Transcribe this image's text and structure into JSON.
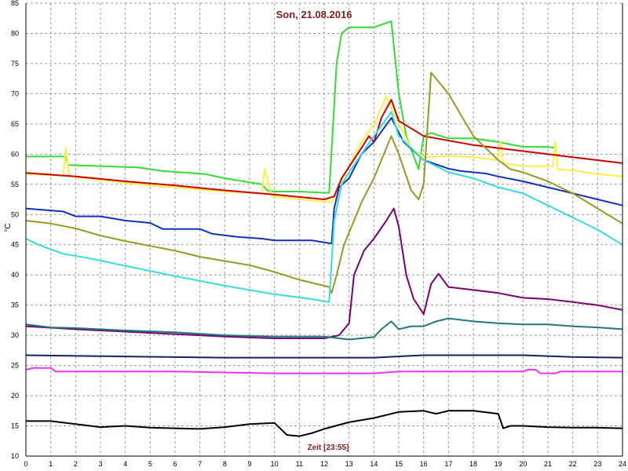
{
  "chart_data": {
    "type": "line",
    "title": "Son, 21.08.2016",
    "xlabel": "Zeit [23:55]",
    "ylabel": "°C",
    "xlim": [
      0,
      24
    ],
    "ylim": [
      10,
      85
    ],
    "x_ticks": [
      0,
      1,
      2,
      3,
      4,
      5,
      6,
      7,
      8,
      9,
      10,
      11,
      12,
      13,
      14,
      15,
      16,
      17,
      18,
      19,
      20,
      21,
      22,
      23,
      24
    ],
    "y_ticks": [
      10,
      15,
      20,
      25,
      30,
      35,
      40,
      45,
      50,
      55,
      60,
      65,
      70,
      75,
      80,
      85
    ],
    "grid": true,
    "series": [
      {
        "color": "#33dd33",
        "points": [
          [
            0,
            59.6
          ],
          [
            1.6,
            59.6
          ],
          [
            1.7,
            58.2
          ],
          [
            4.5,
            57.8
          ],
          [
            5.5,
            57.2
          ],
          [
            7.2,
            56.7
          ],
          [
            8,
            56
          ],
          [
            9.5,
            55
          ],
          [
            9.7,
            54
          ],
          [
            10,
            53.8
          ],
          [
            11,
            53.8
          ],
          [
            12,
            53.6
          ],
          [
            12.2,
            53.6
          ],
          [
            12.5,
            75
          ],
          [
            12.7,
            80
          ],
          [
            13,
            81
          ],
          [
            14,
            81
          ],
          [
            14.7,
            82
          ],
          [
            15,
            70
          ],
          [
            15.3,
            63
          ],
          [
            15.8,
            57.5
          ],
          [
            16,
            63
          ],
          [
            16.3,
            63.5
          ],
          [
            17,
            62.6
          ],
          [
            18,
            62.6
          ],
          [
            19,
            62
          ],
          [
            20,
            61.2
          ],
          [
            21,
            61.2
          ],
          [
            21.3,
            61
          ]
        ]
      },
      {
        "color": "#ffee44",
        "points": [
          [
            0,
            56.7
          ],
          [
            1.5,
            56.4
          ],
          [
            1.6,
            61
          ],
          [
            1.75,
            56.3
          ],
          [
            5,
            54.8
          ],
          [
            8,
            53.8
          ],
          [
            9.5,
            53.5
          ],
          [
            9.6,
            57.6
          ],
          [
            9.9,
            53
          ],
          [
            12.3,
            52
          ],
          [
            12.5,
            54
          ],
          [
            13.5,
            62
          ],
          [
            14,
            65
          ],
          [
            14.5,
            69.5
          ],
          [
            15,
            65
          ],
          [
            15.5,
            61
          ],
          [
            16,
            59.5
          ],
          [
            17,
            59.7
          ],
          [
            18,
            59.5
          ],
          [
            19,
            59
          ],
          [
            19.1,
            62.2
          ],
          [
            19.2,
            58.5
          ],
          [
            20,
            58
          ],
          [
            21.2,
            58
          ],
          [
            21.3,
            62
          ],
          [
            21.4,
            57.5
          ],
          [
            22,
            57.3
          ],
          [
            23,
            56.7
          ],
          [
            24,
            56.3
          ]
        ]
      },
      {
        "color": "#cc0000",
        "points": [
          [
            0,
            56.9
          ],
          [
            2,
            56.3
          ],
          [
            4,
            55.5
          ],
          [
            6,
            54.8
          ],
          [
            8,
            54
          ],
          [
            10,
            53.3
          ],
          [
            12,
            52.5
          ],
          [
            12.4,
            53
          ],
          [
            12.7,
            56
          ],
          [
            13.5,
            61
          ],
          [
            13.8,
            63
          ],
          [
            14,
            62
          ],
          [
            14.3,
            66
          ],
          [
            14.7,
            69
          ],
          [
            15,
            65.5
          ],
          [
            16,
            63
          ],
          [
            18,
            61.5
          ],
          [
            20,
            60.5
          ],
          [
            22,
            59.5
          ],
          [
            24,
            58.5
          ]
        ]
      },
      {
        "color": "#1133bb",
        "points": [
          [
            0,
            51
          ],
          [
            1.5,
            50.5
          ],
          [
            2,
            49.7
          ],
          [
            3,
            49.7
          ],
          [
            4,
            49
          ],
          [
            5,
            48.6
          ],
          [
            5.5,
            47.6
          ],
          [
            7,
            47.6
          ],
          [
            7.5,
            46.8
          ],
          [
            8.5,
            46.3
          ],
          [
            9.5,
            46
          ],
          [
            10,
            45.7
          ],
          [
            11.5,
            45.7
          ],
          [
            12.3,
            45.2
          ],
          [
            12.4,
            51
          ],
          [
            12.6,
            54.5
          ],
          [
            13,
            56
          ],
          [
            13.5,
            60
          ],
          [
            14,
            62
          ],
          [
            14.7,
            66
          ],
          [
            15.2,
            62
          ],
          [
            16,
            59
          ],
          [
            17,
            57.6
          ],
          [
            17.5,
            57.2
          ],
          [
            18.5,
            56.8
          ],
          [
            19,
            56.3
          ],
          [
            20,
            55.5
          ],
          [
            21,
            54.5
          ],
          [
            22,
            53.5
          ],
          [
            23,
            52.5
          ],
          [
            24,
            51.5
          ]
        ]
      },
      {
        "color": "#999922",
        "points": [
          [
            0,
            49
          ],
          [
            1,
            48.5
          ],
          [
            2,
            47.7
          ],
          [
            3,
            46.5
          ],
          [
            4,
            45.6
          ],
          [
            5,
            44.8
          ],
          [
            6,
            44
          ],
          [
            7,
            43
          ],
          [
            8,
            42.3
          ],
          [
            9,
            41.6
          ],
          [
            10,
            40.5
          ],
          [
            11,
            39.2
          ],
          [
            12,
            38.2
          ],
          [
            12.2,
            38
          ],
          [
            12.3,
            37
          ],
          [
            12.5,
            40
          ],
          [
            12.8,
            45
          ],
          [
            13.5,
            52
          ],
          [
            14,
            56
          ],
          [
            14.7,
            63
          ],
          [
            15,
            60
          ],
          [
            15.5,
            54
          ],
          [
            15.8,
            52.5
          ],
          [
            16,
            55
          ],
          [
            16.3,
            73.5
          ],
          [
            16.6,
            72
          ],
          [
            17,
            70
          ],
          [
            18,
            63
          ],
          [
            19,
            59
          ],
          [
            19.5,
            57.5
          ],
          [
            20,
            57
          ],
          [
            21,
            55.5
          ],
          [
            22,
            53.5
          ],
          [
            23,
            51
          ],
          [
            24,
            48.5
          ]
        ]
      },
      {
        "color": "#33dddd",
        "points": [
          [
            0,
            46
          ],
          [
            0.5,
            45
          ],
          [
            1.5,
            43.5
          ],
          [
            2.5,
            42.8
          ],
          [
            4,
            41.5
          ],
          [
            6,
            39.8
          ],
          [
            8,
            38.2
          ],
          [
            10,
            36.8
          ],
          [
            11.5,
            36
          ],
          [
            12.2,
            35.5
          ],
          [
            12.4,
            49
          ],
          [
            12.7,
            55
          ],
          [
            13,
            57
          ],
          [
            13.5,
            60
          ],
          [
            14,
            63
          ],
          [
            14.7,
            67
          ],
          [
            15,
            63
          ],
          [
            16,
            59
          ],
          [
            17,
            57
          ],
          [
            18,
            56
          ],
          [
            19,
            54.5
          ],
          [
            20,
            53.5
          ],
          [
            21,
            51.5
          ],
          [
            22,
            49.5
          ],
          [
            23,
            47.5
          ],
          [
            24,
            45
          ]
        ]
      },
      {
        "color": "#770077",
        "points": [
          [
            0,
            31.5
          ],
          [
            2,
            31
          ],
          [
            4,
            30.6
          ],
          [
            6,
            30.2
          ],
          [
            8,
            29.8
          ],
          [
            10,
            29.5
          ],
          [
            12,
            29.5
          ],
          [
            12.6,
            30
          ],
          [
            13,
            32
          ],
          [
            13.2,
            40
          ],
          [
            13.6,
            44
          ],
          [
            14,
            46
          ],
          [
            14.5,
            49
          ],
          [
            14.8,
            51
          ],
          [
            15,
            48
          ],
          [
            15.3,
            40
          ],
          [
            15.6,
            36
          ],
          [
            16,
            33.5
          ],
          [
            16.3,
            38.5
          ],
          [
            16.6,
            40.2
          ],
          [
            17,
            38
          ],
          [
            18,
            37.5
          ],
          [
            19,
            37
          ],
          [
            20,
            36.2
          ],
          [
            21,
            36
          ],
          [
            22,
            35.5
          ],
          [
            23,
            35
          ],
          [
            24,
            34.2
          ]
        ]
      },
      {
        "color": "#227777",
        "points": [
          [
            0,
            31.8
          ],
          [
            1,
            31.3
          ],
          [
            2,
            31.2
          ],
          [
            4,
            30.8
          ],
          [
            6,
            30.5
          ],
          [
            8,
            30
          ],
          [
            10,
            29.8
          ],
          [
            12,
            29.8
          ],
          [
            13,
            29.3
          ],
          [
            14,
            29.7
          ],
          [
            14.3,
            31
          ],
          [
            14.7,
            32.3
          ],
          [
            15,
            31
          ],
          [
            15.5,
            31.5
          ],
          [
            16,
            31.5
          ],
          [
            16.5,
            32.3
          ],
          [
            17,
            32.8
          ],
          [
            18,
            32.3
          ],
          [
            19,
            32
          ],
          [
            20,
            31.8
          ],
          [
            21,
            31.8
          ],
          [
            22,
            31.5
          ],
          [
            23,
            31.3
          ],
          [
            24,
            31
          ]
        ]
      },
      {
        "color": "#112266",
        "points": [
          [
            0,
            26.7
          ],
          [
            4,
            26.5
          ],
          [
            8,
            26.3
          ],
          [
            12,
            26.3
          ],
          [
            14,
            26.3
          ],
          [
            16,
            26.7
          ],
          [
            18,
            26.7
          ],
          [
            20,
            26.7
          ],
          [
            22,
            26.4
          ],
          [
            24,
            26.3
          ]
        ]
      },
      {
        "color": "#ee33ee",
        "points": [
          [
            0,
            24.3
          ],
          [
            0.3,
            24.6
          ],
          [
            1,
            24.6
          ],
          [
            1.2,
            24
          ],
          [
            3,
            24
          ],
          [
            6,
            24
          ],
          [
            10,
            23.7
          ],
          [
            14,
            23.7
          ],
          [
            15,
            24
          ],
          [
            20,
            24
          ],
          [
            20.2,
            24.3
          ],
          [
            20.5,
            24.3
          ],
          [
            20.7,
            23.7
          ],
          [
            21.3,
            23.7
          ],
          [
            21.5,
            24
          ],
          [
            24,
            24
          ]
        ]
      },
      {
        "color": "#000000",
        "points": [
          [
            0,
            15.8
          ],
          [
            1,
            15.8
          ],
          [
            2,
            15.3
          ],
          [
            3,
            14.8
          ],
          [
            4,
            15
          ],
          [
            5,
            14.7
          ],
          [
            6,
            14.6
          ],
          [
            7,
            14.5
          ],
          [
            8,
            14.8
          ],
          [
            9,
            15.3
          ],
          [
            10,
            15.5
          ],
          [
            10.5,
            13.5
          ],
          [
            11,
            13.3
          ],
          [
            11.5,
            13.8
          ],
          [
            12,
            14.5
          ],
          [
            13,
            15.6
          ],
          [
            14,
            16.3
          ],
          [
            15,
            17.3
          ],
          [
            16,
            17.5
          ],
          [
            16.5,
            17
          ],
          [
            17,
            17.5
          ],
          [
            18,
            17.5
          ],
          [
            19,
            17
          ],
          [
            19.2,
            14.6
          ],
          [
            19.5,
            15
          ],
          [
            20,
            15
          ],
          [
            21,
            14.8
          ],
          [
            22,
            14.7
          ],
          [
            23,
            14.7
          ],
          [
            24,
            14.6
          ]
        ]
      }
    ]
  }
}
